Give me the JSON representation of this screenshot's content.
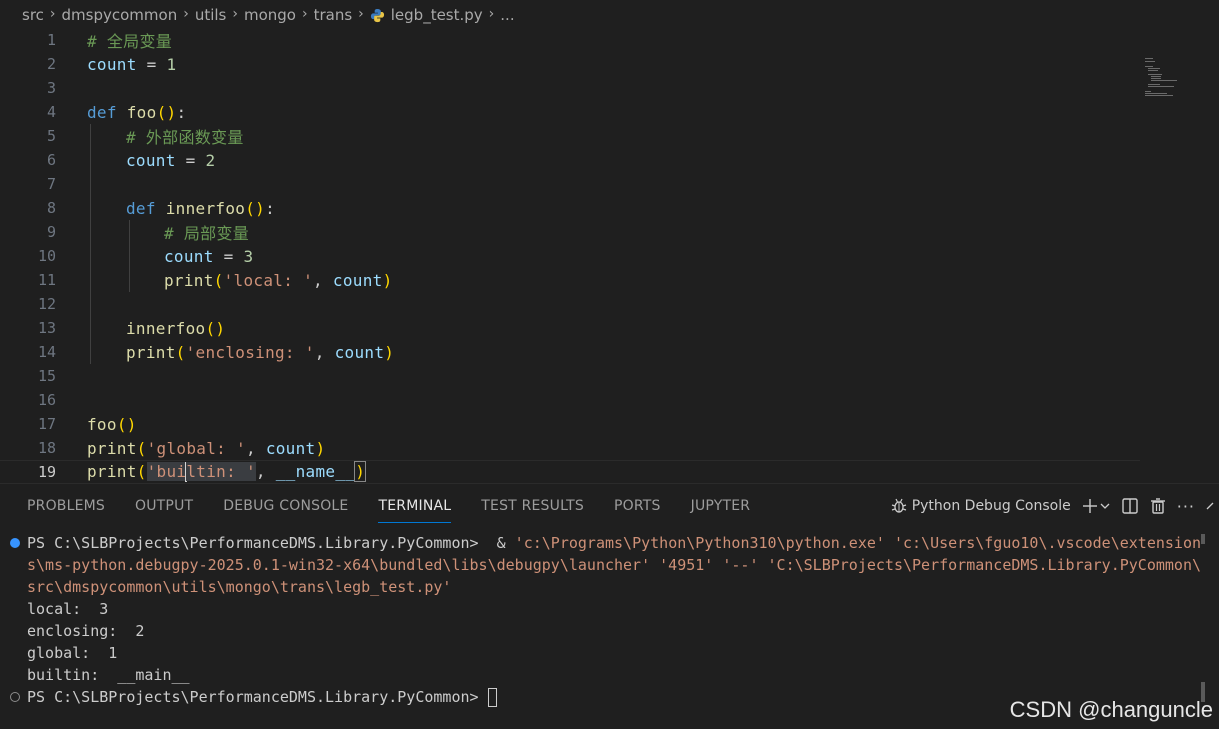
{
  "breadcrumb": {
    "items": [
      "src",
      "dmspycommon",
      "utils",
      "mongo",
      "trans"
    ],
    "file": "legb_test.py",
    "more": "..."
  },
  "editor": {
    "line_numbers": [
      "1",
      "2",
      "3",
      "4",
      "5",
      "6",
      "7",
      "8",
      "9",
      "10",
      "11",
      "12",
      "13",
      "14",
      "15",
      "16",
      "17",
      "18",
      "19"
    ],
    "active_line": "19",
    "code": {
      "l1_comment": "# 全局变量",
      "l2_var": "count",
      "l2_op": " = ",
      "l2_num": "1",
      "l4_kw": "def",
      "l4_fn": "foo",
      "l5_comment": "# 外部函数变量",
      "l6_var": "count",
      "l6_num": "2",
      "l8_kw": "def",
      "l8_fn": "innerfoo",
      "l9_comment": "# 局部变量",
      "l10_var": "count",
      "l10_num": "3",
      "l11_fn": "print",
      "l11_str": "'local: '",
      "l11_var": "count",
      "l13_fn": "innerfoo",
      "l14_fn": "print",
      "l14_str": "'enclosing: '",
      "l14_var": "count",
      "l17_fn": "foo",
      "l18_fn": "print",
      "l18_str": "'global: '",
      "l18_var": "count",
      "l19_fn": "print",
      "l19_str_a": "'bui",
      "l19_str_b": "ltin: '",
      "l19_var": "__name__"
    }
  },
  "panel": {
    "tabs": [
      "PROBLEMS",
      "OUTPUT",
      "DEBUG CONSOLE",
      "TERMINAL",
      "TEST RESULTS",
      "PORTS",
      "JUPYTER"
    ],
    "active_tab": "TERMINAL",
    "terminal_name": "Python Debug Console",
    "more": "···"
  },
  "terminal": {
    "prompt": "PS C:\\SLBProjects\\PerformanceDMS.Library.PyCommon> ",
    "cmd_amp": " & ",
    "cmd_line1": "'c:\\Programs\\Python\\Python310\\python.exe' 'c:\\Users\\fguo10\\.vscode\\extension",
    "cmd_line2": "s\\ms-python.debugpy-2025.0.1-win32-x64\\bundled\\libs\\debugpy\\launcher' '4951' '--' 'C:\\SLBProjects\\PerformanceDMS.Library.PyCommon\\",
    "cmd_line3": "src\\dmspycommon\\utils\\mongo\\trans\\legb_test.py'",
    "out_local": "local:  3",
    "out_enclosing": "enclosing:  2",
    "out_global": "global:  1",
    "out_builtin": "builtin:  __main__",
    "prompt2": "PS C:\\SLBProjects\\PerformanceDMS.Library.PyCommon> "
  },
  "watermark": "CSDN @changuncle",
  "colors": {
    "background": "#1f1f1f",
    "keyword": "#569cd6",
    "function": "#dcdcaa",
    "variable": "#9cdcfe",
    "string": "#ce9178",
    "comment": "#6a9955",
    "number": "#b5cea8",
    "active_tab_underline": "#0078d4"
  }
}
